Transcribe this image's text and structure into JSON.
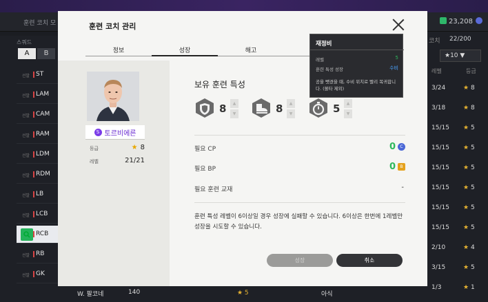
{
  "background": {
    "title": "훈련 코치 모",
    "currency": "23,208",
    "squad_label": "스쿼드",
    "tab_a": "A",
    "tab_b": "B",
    "rows": [
      {
        "tag": "선발",
        "pos": "ST"
      },
      {
        "tag": "선발",
        "pos": "LAM"
      },
      {
        "tag": "선발",
        "pos": "CAM"
      },
      {
        "tag": "선발",
        "pos": "RAM"
      },
      {
        "tag": "선발",
        "pos": "LDM"
      },
      {
        "tag": "선발",
        "pos": "RDM"
      },
      {
        "tag": "선발",
        "pos": "LB"
      },
      {
        "tag": "선발",
        "pos": "LCB"
      },
      {
        "tag": "",
        "pos": "RCB"
      },
      {
        "tag": "선발",
        "pos": "RB"
      },
      {
        "tag": "선발",
        "pos": "GK"
      }
    ],
    "coach_label": "코치",
    "coach_count": "22/200",
    "star_filter": "★10 ▼",
    "col_level": "레벨",
    "col_grade": "등급",
    "right_rows": [
      {
        "level": "3/24",
        "grade": "8"
      },
      {
        "level": "3/18",
        "grade": "8"
      },
      {
        "level": "15/15",
        "grade": "5"
      },
      {
        "level": "15/15",
        "grade": "5"
      },
      {
        "level": "15/15",
        "grade": "5"
      },
      {
        "level": "15/15",
        "grade": "5"
      },
      {
        "level": "15/15",
        "grade": "5"
      },
      {
        "level": "15/15",
        "grade": "5"
      },
      {
        "level": "2/10",
        "grade": "4"
      },
      {
        "level": "3/15",
        "grade": "5"
      },
      {
        "level": "1/3",
        "grade": "1"
      }
    ],
    "bottom_name": "W. 팔코네",
    "bottom_num": "140",
    "bottom_star": "★ 5",
    "bottom_name2": "아식"
  },
  "modal": {
    "title": "훈련 코치 관리",
    "tabs": [
      "정보",
      "성장",
      "해고"
    ],
    "active_tab": "성장",
    "coach": {
      "name": "토르비에른",
      "grade_label": "등급",
      "grade_value": "8",
      "level_label": "레벨",
      "level_value": "21/21"
    },
    "section_title": "보유 훈련 특성",
    "traits": [
      {
        "icon": "shield-trait-icon",
        "value": "8"
      },
      {
        "icon": "boot-trait-icon",
        "value": "8"
      },
      {
        "icon": "stopwatch-trait-icon",
        "value": "5"
      }
    ],
    "costs": {
      "cp_label": "필요 CP",
      "cp_value": "0",
      "bp_label": "필요 BP",
      "bp_value": "0",
      "material_label": "필요 훈련 교재",
      "material_value": "-"
    },
    "notice": "훈련 특성 레벨이 6이상일 경우 성장에 실패할 수 있습니다. 6이상은 한번에 1레벨만 성장을 시도할 수 있습니다.",
    "grow_button": "성장",
    "cancel_button": "취소"
  },
  "tooltip": {
    "title": "재정비",
    "level_label": "레벨",
    "level_value": "5",
    "growth_label": "훈련 특성 성장",
    "growth_value": "수비",
    "description": "공을 뺏겼을 때, 수비 위치로 빨리 복귀합니다. (볼타 제외)"
  },
  "colors": {
    "accent_green": "#2eb85c",
    "name_purple": "#6a2bd1",
    "tooltip_blue": "#4aa3ff"
  }
}
